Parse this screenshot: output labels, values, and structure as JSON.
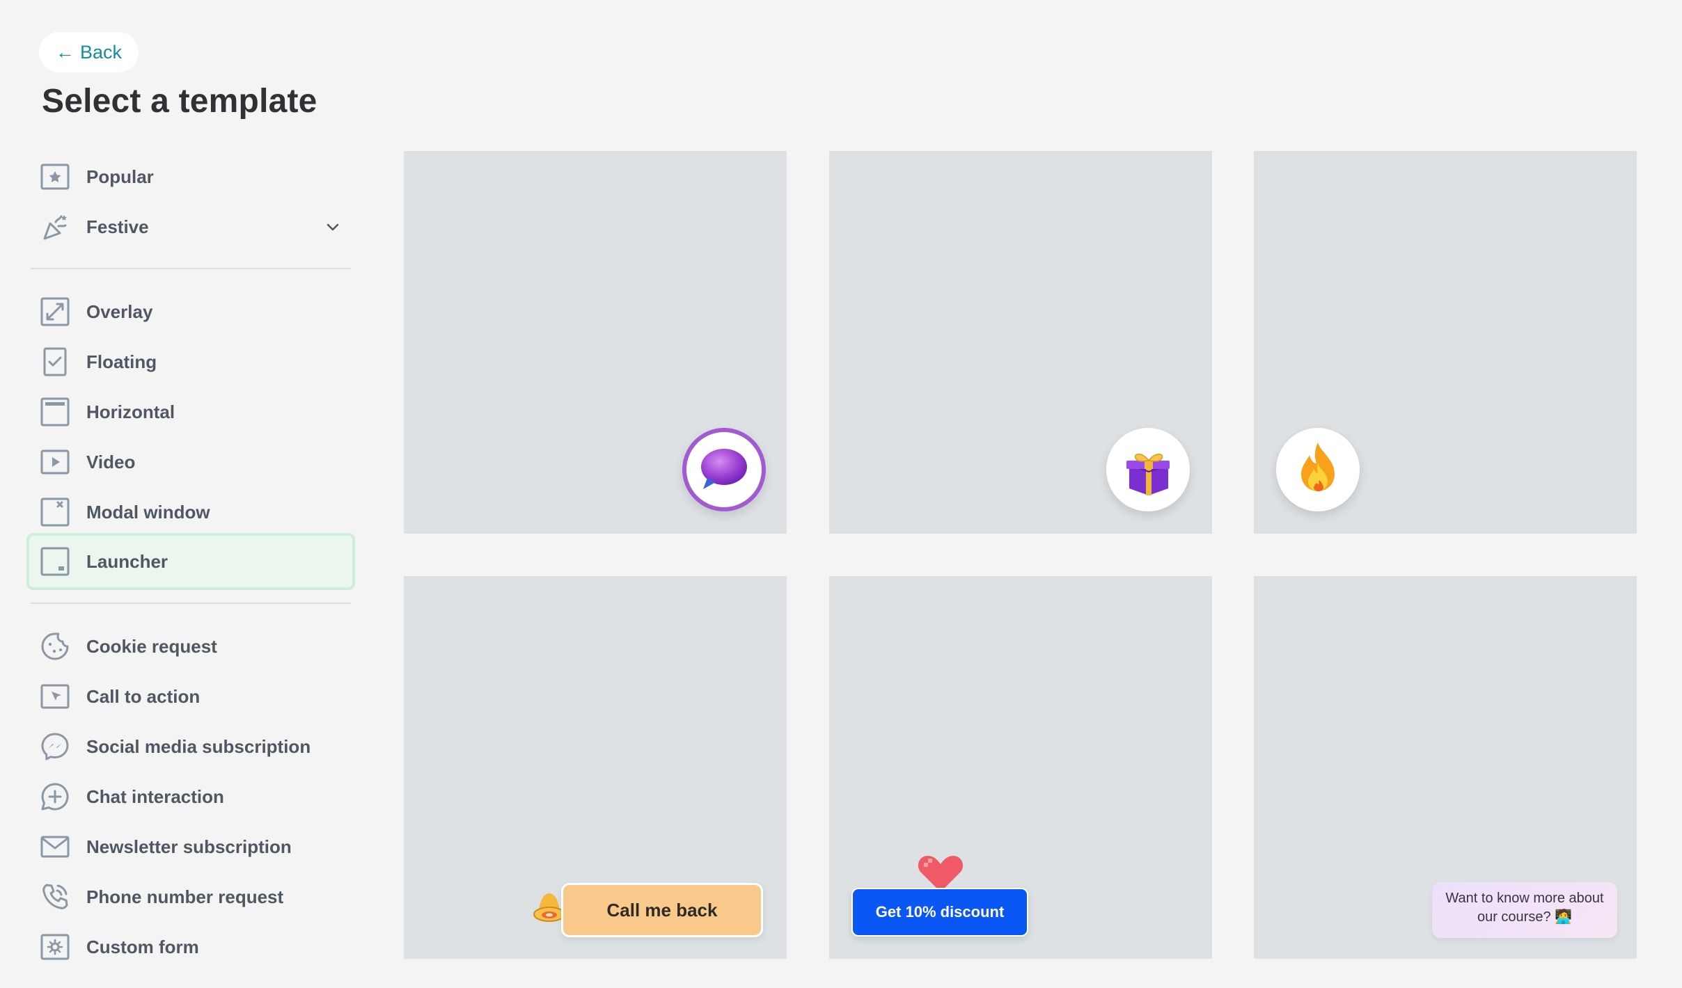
{
  "header": {
    "back_label": "Back",
    "back_arrow": "←",
    "title": "Select a template"
  },
  "sidebar": {
    "groups": [
      {
        "items": [
          {
            "label": "Popular",
            "icon": "star-icon"
          },
          {
            "label": "Festive",
            "icon": "party-popper-icon",
            "expandable": true
          }
        ]
      },
      {
        "items": [
          {
            "label": "Overlay",
            "icon": "expand-icon"
          },
          {
            "label": "Floating",
            "icon": "checkbox-icon"
          },
          {
            "label": "Horizontal",
            "icon": "horizontal-bar-icon"
          },
          {
            "label": "Video",
            "icon": "play-icon"
          },
          {
            "label": "Modal window",
            "icon": "modal-close-icon"
          },
          {
            "label": "Launcher",
            "icon": "launcher-icon",
            "active": true
          }
        ]
      },
      {
        "items": [
          {
            "label": "Cookie request",
            "icon": "cookie-icon"
          },
          {
            "label": "Call to action",
            "icon": "cursor-click-icon"
          },
          {
            "label": "Social media subscription",
            "icon": "messenger-icon"
          },
          {
            "label": "Chat interaction",
            "icon": "chat-plus-icon"
          },
          {
            "label": "Newsletter subscription",
            "icon": "envelope-icon"
          },
          {
            "label": "Phone number request",
            "icon": "phone-icon"
          },
          {
            "label": "Custom form",
            "icon": "gear-form-icon"
          }
        ]
      }
    ]
  },
  "templates": [
    {
      "kind": "chat-bubble-launcher",
      "icon": "speech-bubble-icon"
    },
    {
      "kind": "gift-launcher",
      "icon": "gift-icon"
    },
    {
      "kind": "fire-launcher",
      "icon": "flame-icon"
    },
    {
      "kind": "call-back-button",
      "label": "Call me back",
      "icon": "bell-icon"
    },
    {
      "kind": "discount-button",
      "label": "Get 10% discount",
      "icon": "heart-icon"
    },
    {
      "kind": "course-bubble",
      "label": "Want to know more about our course? 🧑‍💻"
    }
  ],
  "colors": {
    "accent": "#138f9c",
    "active_bg": "#eaf6ee",
    "active_border": "#cdeed9",
    "card_bg": "#dde1e4",
    "discount_blue": "#0b57f5",
    "callback_orange": "#f9c98c"
  }
}
